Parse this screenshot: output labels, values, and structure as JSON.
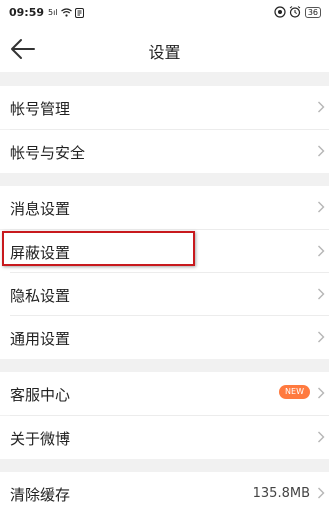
{
  "status_bar": {
    "time": "09:59",
    "signal": "5ıl",
    "battery": "36"
  },
  "header": {
    "title": "设置"
  },
  "sections": {
    "account": [
      {
        "label": "帐号管理"
      },
      {
        "label": "帐号与安全"
      }
    ],
    "settings": [
      {
        "label": "消息设置"
      },
      {
        "label": "屏蔽设置"
      },
      {
        "label": "隐私设置"
      },
      {
        "label": "通用设置"
      }
    ],
    "about": [
      {
        "label": "客服中心",
        "badge": "NEW"
      },
      {
        "label": "关于微博"
      }
    ],
    "storage": [
      {
        "label": "清除缓存",
        "value": "135.8MB"
      }
    ]
  },
  "colors": {
    "highlight": "#c8191d",
    "badge": "#ff7a3f",
    "background": "#f1f1f1"
  }
}
